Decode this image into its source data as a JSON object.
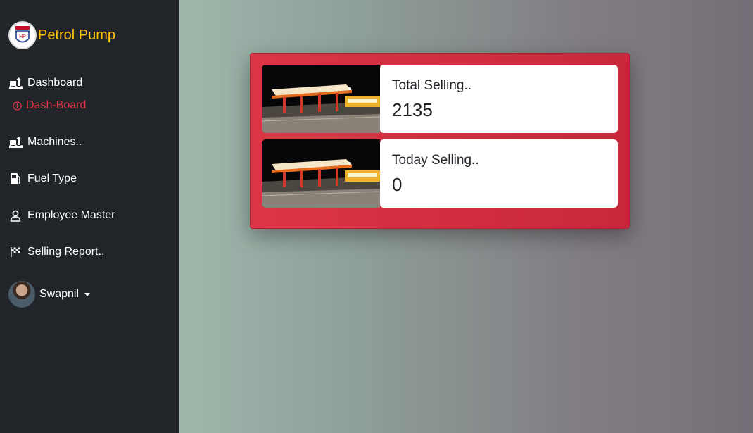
{
  "brand": {
    "name": "Petrol Pump",
    "logo_text": "HP"
  },
  "sidebar": {
    "items": [
      {
        "label": "Dashboard",
        "icon": "dashboard-icon"
      },
      {
        "label": "Dash-Board",
        "icon": "plus-circle-icon",
        "sub": true
      },
      {
        "label": "Machines..",
        "icon": "machines-icon"
      },
      {
        "label": "Fuel Type",
        "icon": "fuel-pump-icon"
      },
      {
        "label": "Employee Master",
        "icon": "person-icon"
      },
      {
        "label": "Selling Report..",
        "icon": "checkered-flag-icon"
      }
    ],
    "user": {
      "name": "Swapnil"
    }
  },
  "cards": [
    {
      "title": "Total Selling..",
      "value": "2135"
    },
    {
      "title": "Today Selling..",
      "value": "0"
    }
  ],
  "colors": {
    "sidebar": "#212529",
    "brand": "#ffc107",
    "active": "#dc3545",
    "panel": "#dc3545"
  }
}
